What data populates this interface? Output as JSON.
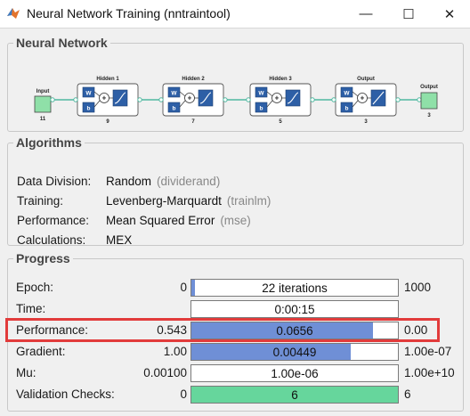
{
  "window": {
    "title": "Neural Network Training (nntraintool)",
    "minimize_glyph": "—",
    "maximize_glyph": "☐",
    "close_glyph": "✕"
  },
  "network": {
    "section_title": "Neural Network",
    "input": {
      "label": "Input",
      "size": "11"
    },
    "layers": [
      {
        "label": "Hidden 1",
        "size": "9",
        "transfer": "sigmoid"
      },
      {
        "label": "Hidden 2",
        "size": "7",
        "transfer": "sigmoid"
      },
      {
        "label": "Hidden 3",
        "size": "5",
        "transfer": "sigmoid"
      },
      {
        "label": "Output",
        "size": "3",
        "transfer": "linear"
      }
    ],
    "output": {
      "label": "Output",
      "size": "3"
    },
    "weight_symbol": "W",
    "bias_symbol": "b",
    "sum_symbol": "+"
  },
  "algorithms": {
    "section_title": "Algorithms",
    "rows": [
      {
        "label": "Data Division:",
        "value": "Random",
        "code": "(dividerand)"
      },
      {
        "label": "Training:",
        "value": "Levenberg-Marquardt",
        "code": "(trainlm)"
      },
      {
        "label": "Performance:",
        "value": "Mean Squared Error",
        "code": "(mse)"
      },
      {
        "label": "Calculations:",
        "value": "MEX",
        "code": ""
      }
    ]
  },
  "progress": {
    "section_title": "Progress",
    "rows": [
      {
        "label": "Epoch:",
        "min": "0",
        "value": "22 iterations",
        "max": "1000",
        "fill_fraction": 0.022,
        "fill_color": "#6f8fd6"
      },
      {
        "label": "Time:",
        "min": "",
        "value": "0:00:15",
        "max": "",
        "fill_fraction": 0,
        "fill_color": "#6f8fd6"
      },
      {
        "label": "Performance:",
        "min": "0.543",
        "value": "0.0656",
        "max": "0.00",
        "fill_fraction": 0.88,
        "fill_color": "#6f8fd6"
      },
      {
        "label": "Gradient:",
        "min": "1.00",
        "value": "0.00449",
        "max": "1.00e-07",
        "fill_fraction": 0.77,
        "fill_color": "#6f8fd6"
      },
      {
        "label": "Mu:",
        "min": "0.00100",
        "value": "1.00e-06",
        "max": "1.00e+10",
        "fill_fraction": 0,
        "fill_color": "#6f8fd6"
      },
      {
        "label": "Validation Checks:",
        "min": "0",
        "value": "6",
        "max": "6",
        "fill_fraction": 1.0,
        "fill_color": "#66d69c"
      }
    ]
  },
  "colors": {
    "highlight": "#e23b3b",
    "io_block": "#8fe0a8",
    "connector": "#4fb8a0"
  }
}
